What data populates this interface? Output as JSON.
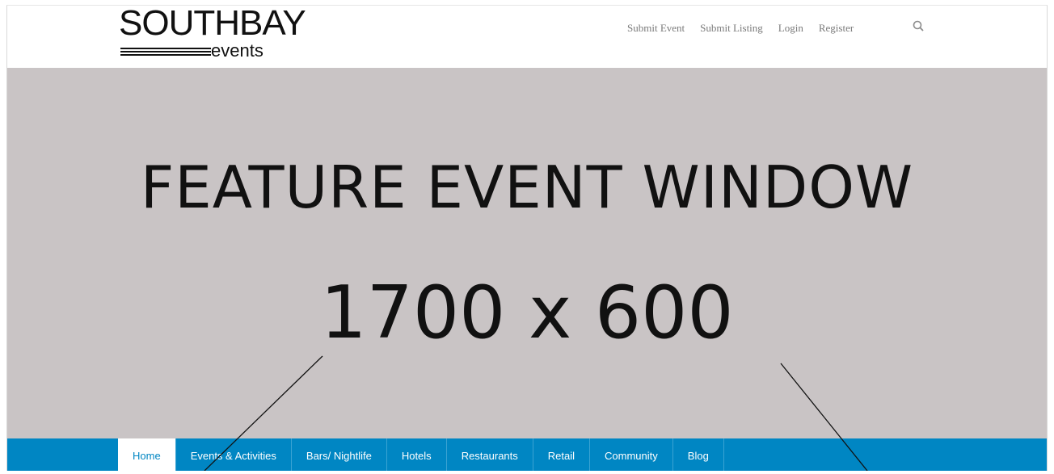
{
  "logo": {
    "main": "SOUTHBAY",
    "sub": "events"
  },
  "topnav": [
    "Submit Event",
    "Submit Listing",
    "Login",
    "Register"
  ],
  "hero": {
    "title": "FEATURE EVENT WINDOW",
    "size": "1700 x 600"
  },
  "nav": [
    "Home",
    "Events & Activities",
    "Bars/ Nightlife",
    "Hotels",
    "Restaurants",
    "Retail",
    "Community",
    "Blog"
  ],
  "colors": {
    "hero_bg": "#c9c4c5",
    "nav_bg": "#0086c3",
    "topnav_text": "#7a7a7a"
  },
  "icons": {
    "search": "search-icon"
  }
}
